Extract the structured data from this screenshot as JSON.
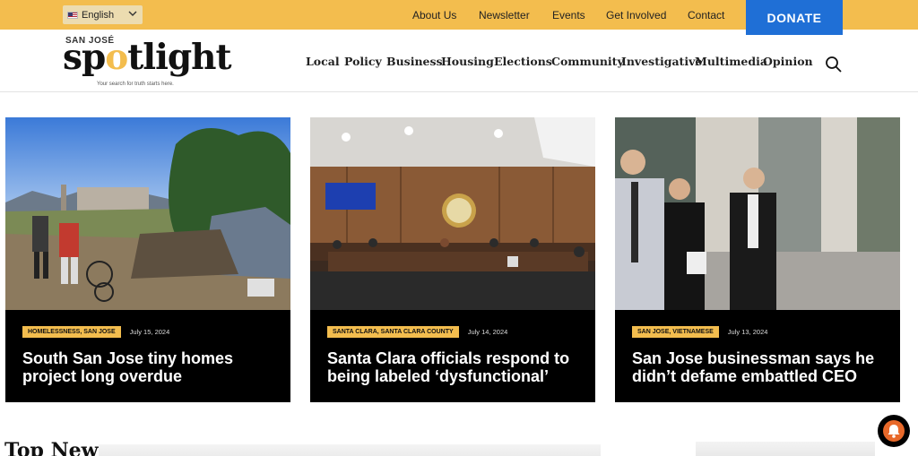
{
  "topbar": {
    "language": "English",
    "links": [
      "About Us",
      "Newsletter",
      "Events",
      "Get Involved",
      "Contact"
    ],
    "donate": "DONATE"
  },
  "logo": {
    "prefix": "SAN JOSÉ",
    "word_a": "sp",
    "word_b": "tlight",
    "tagline": "Your search for truth starts here."
  },
  "nav": [
    "Local",
    "Policy",
    "Business",
    "Housing",
    "Elections",
    "Community",
    "Investigative",
    "Multimedia",
    "Opinion"
  ],
  "articles": [
    {
      "category": "HOMELESSNESS, SAN JOSE",
      "date": "July 15, 2024",
      "title": "South San Jose tiny homes project long overdue"
    },
    {
      "category": "SANTA CLARA, SANTA CLARA COUNTY",
      "date": "July 14, 2024",
      "title": "Santa Clara officials respond to being labeled ‘dysfunctional’"
    },
    {
      "category": "SAN JOSE, VIETNAMESE",
      "date": "July 13, 2024",
      "title": "San Jose businessman says he didn’t defame embattled CEO"
    }
  ],
  "sections": {
    "top_news": "Top News"
  },
  "colors": {
    "accent": "#f3bd4e",
    "donate": "#1f6fd6",
    "card_bg": "#000000"
  },
  "icons": {
    "search": "search-icon",
    "notification": "bell-icon",
    "language_toggle": "chevron-down-icon"
  }
}
